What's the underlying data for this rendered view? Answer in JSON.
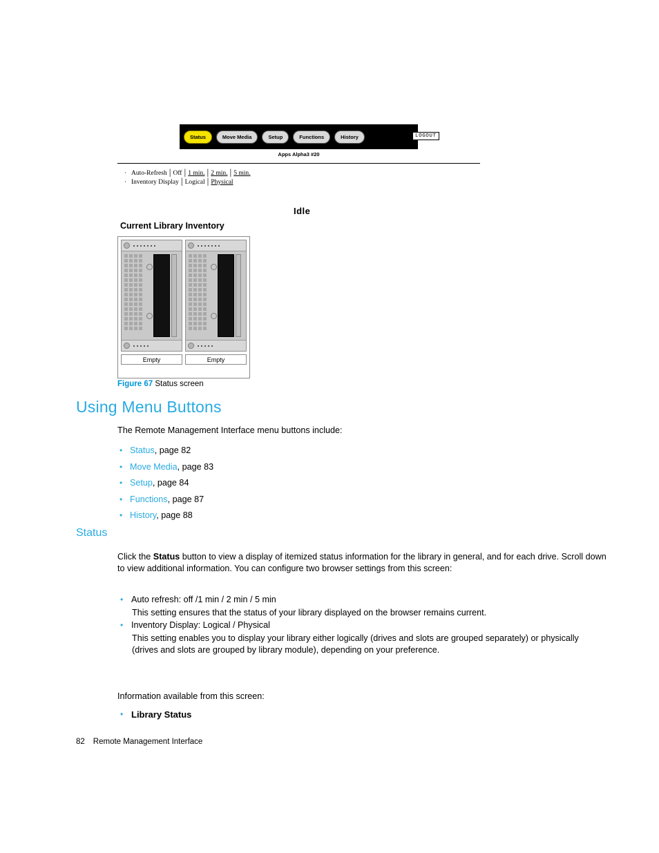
{
  "figure": {
    "menu_buttons": [
      {
        "label": "Status",
        "active": true
      },
      {
        "label": "Move Media",
        "active": false
      },
      {
        "label": "Setup",
        "active": false
      },
      {
        "label": "Functions",
        "active": false
      },
      {
        "label": "History",
        "active": false
      }
    ],
    "logout_label": "LOGOUT",
    "apps_line": "Apps Alpha3 #20",
    "options": {
      "auto_refresh_label": "Auto-Refresh",
      "auto_refresh_values": [
        "Off",
        "1 min.",
        "2 min.",
        "5 min."
      ],
      "inventory_display_label": "Inventory Display",
      "inventory_display_values": [
        "Logical",
        "Physical"
      ],
      "inventory_display_selected": "Physical"
    },
    "state_label": "Idle",
    "inventory_title": "Current Library Inventory",
    "module_status": [
      "Empty",
      "Empty"
    ],
    "accent_yellow": "#f5e300"
  },
  "caption": {
    "number": "Figure 67",
    "text": "Status screen"
  },
  "headings": {
    "section": "Using Menu Buttons",
    "subsection": "Status"
  },
  "intro_text": "The Remote Management Interface menu buttons include:",
  "menu_links": [
    {
      "link": "Status",
      "rest": ", page 82"
    },
    {
      "link": "Move Media",
      "rest": ", page 83"
    },
    {
      "link": "Setup",
      "rest": ", page 84"
    },
    {
      "link": "Functions",
      "rest": ", page 87"
    },
    {
      "link": "History",
      "rest": ", page 88"
    }
  ],
  "status_paragraph": {
    "pre": "Click the ",
    "bold": "Status",
    "post": " button to view a display of itemized status information for the library in general, and for each drive. Scroll down to view additional information. You can configure two browser settings from this screen:"
  },
  "settings_bullets": [
    {
      "main": "Auto refresh: off /1 min / 2 min / 5 min",
      "sub": "This setting ensures that the status of your library displayed on the browser remains current."
    },
    {
      "main": "Inventory Display: Logical / Physical",
      "sub": "This setting enables you to display your library either logically (drives and slots are grouped separately) or physically (drives and slots are grouped by library module), depending on your preference."
    }
  ],
  "info_available_text": "Information available from this screen:",
  "info_items": [
    "Library Status"
  ],
  "footer": {
    "page_number": "82",
    "title": "Remote Management Interface"
  },
  "colors": {
    "accent_blue": "#29abe2",
    "caption_blue": "#0096d6"
  }
}
